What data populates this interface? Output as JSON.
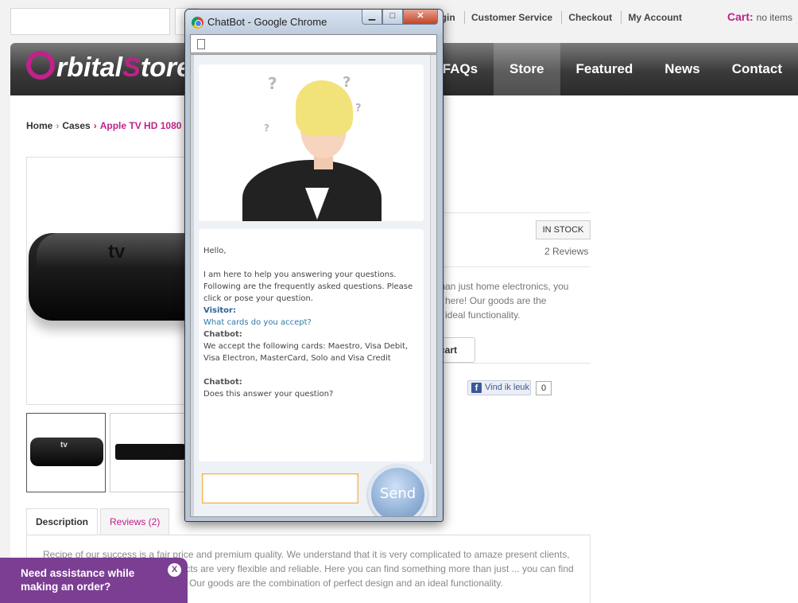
{
  "store": {
    "top_links": [
      "Login",
      "Customer Service",
      "Checkout",
      "My Account"
    ],
    "cart": {
      "label": "Cart:",
      "value": "no items"
    },
    "logo": {
      "first": "rbital",
      "second": "S",
      "third": "tore"
    },
    "nav": [
      "FAQs",
      "Store",
      "Featured",
      "News",
      "Contact"
    ],
    "breadcrumb": {
      "home": "Home",
      "category": "Cases",
      "current": "Apple TV HD 1080",
      "sep": "›"
    },
    "product": {
      "stock": "IN STOCK",
      "reviews": "2 Reviews",
      "description_fragment": [
        "than just home electronics, you",
        "n here! Our goods are the",
        "n ideal functionality."
      ],
      "cart_button_fragment": "cart",
      "fb_like": "Vind ik leuk",
      "fb_count": "0",
      "tv_label": "tv"
    },
    "tabs": {
      "description": "Description",
      "reviews": "Reviews (2)"
    },
    "tab_text": "Recipe of our success is a fair price and premium quality. We understand that it is very complicated to amaze present clients, they are so whimsical... our products are very flexible and reliable. Here you can find something more than just ... you can find real comfort and satisfaction here! Our goods are the combination of perfect design and an ideal functionality.",
    "assist": {
      "text": "Need assistance while making an order?",
      "close": "X"
    }
  },
  "popup": {
    "title": "ChatBot - Google Chrome",
    "window_controls": {
      "minimize": "▁",
      "maximize": "□",
      "close": "✕"
    },
    "question_marks": [
      "?",
      "?",
      "?",
      "?"
    ],
    "chat": {
      "greeting": "Hello,",
      "intro": "I am here to help you answering your questions. Following are the frequently asked questions. Please click or pose your question.",
      "visitor_label": "Visitor:",
      "visitor_question": "What cards do you accept?",
      "bot_label_1": "Chatbot:",
      "bot_answer": "We accept the following cards: Maestro, Visa Debit, Visa Electron, MasterCard, Solo and Visa Credit",
      "bot_label_2": "Chatbot:",
      "bot_followup": "Does this answer your question?"
    },
    "input_value": "",
    "send_label": "Send"
  },
  "colors": {
    "accent": "#c0218a",
    "assist_bg": "#7b3e93",
    "chat_link": "#2a7aa6"
  }
}
